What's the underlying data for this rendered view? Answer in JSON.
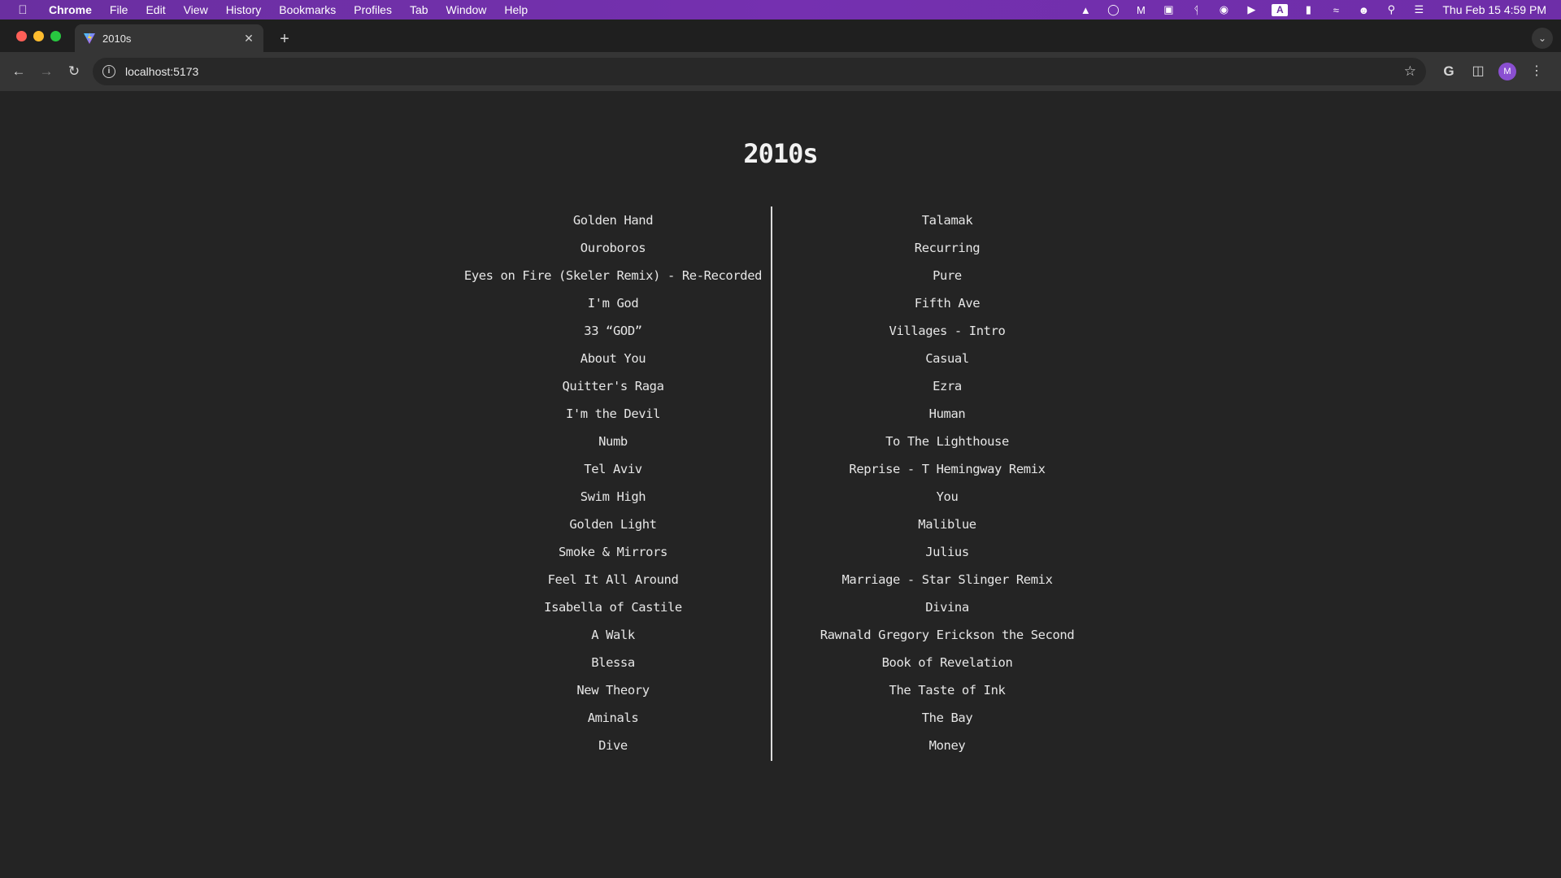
{
  "menubar": {
    "app": "Chrome",
    "items": [
      "File",
      "Edit",
      "View",
      "History",
      "Bookmarks",
      "Profiles",
      "Tab",
      "Window",
      "Help"
    ],
    "input_source": "A",
    "clock": "Thu Feb 15  4:59 PM"
  },
  "browser": {
    "tab_title": "2010s",
    "url": "localhost:5173",
    "avatar_letter": "M"
  },
  "page": {
    "title": "2010s",
    "left_songs": [
      "Golden Hand",
      "Ouroboros",
      "Eyes on Fire (Skeler Remix) - Re-Recorded",
      "I'm God",
      "33 “GOD”",
      "About You",
      "Quitter's Raga",
      "I'm the Devil",
      "Numb",
      "Tel Aviv",
      "Swim High",
      "Golden Light",
      "Smoke & Mirrors",
      "Feel It All Around",
      "Isabella of Castile",
      "A Walk",
      "Blessa",
      "New Theory",
      "Aminals",
      "Dive"
    ],
    "right_songs": [
      "Talamak",
      "Recurring",
      "Pure",
      "Fifth Ave",
      "Villages - Intro",
      "Casual",
      "Ezra",
      "Human",
      "To The Lighthouse",
      "Reprise - T Hemingway Remix",
      "You",
      "Maliblue",
      "Julius",
      "Marriage - Star Slinger Remix",
      "Divina",
      "Rawnald Gregory Erickson the Second",
      "Book of Revelation",
      "The Taste of Ink",
      "The Bay",
      "Money"
    ]
  },
  "colors": {
    "menubar": "#6a2fa0",
    "page_bg": "#242424",
    "text": "#e6e6e6",
    "divider": "#dcdcdc"
  }
}
